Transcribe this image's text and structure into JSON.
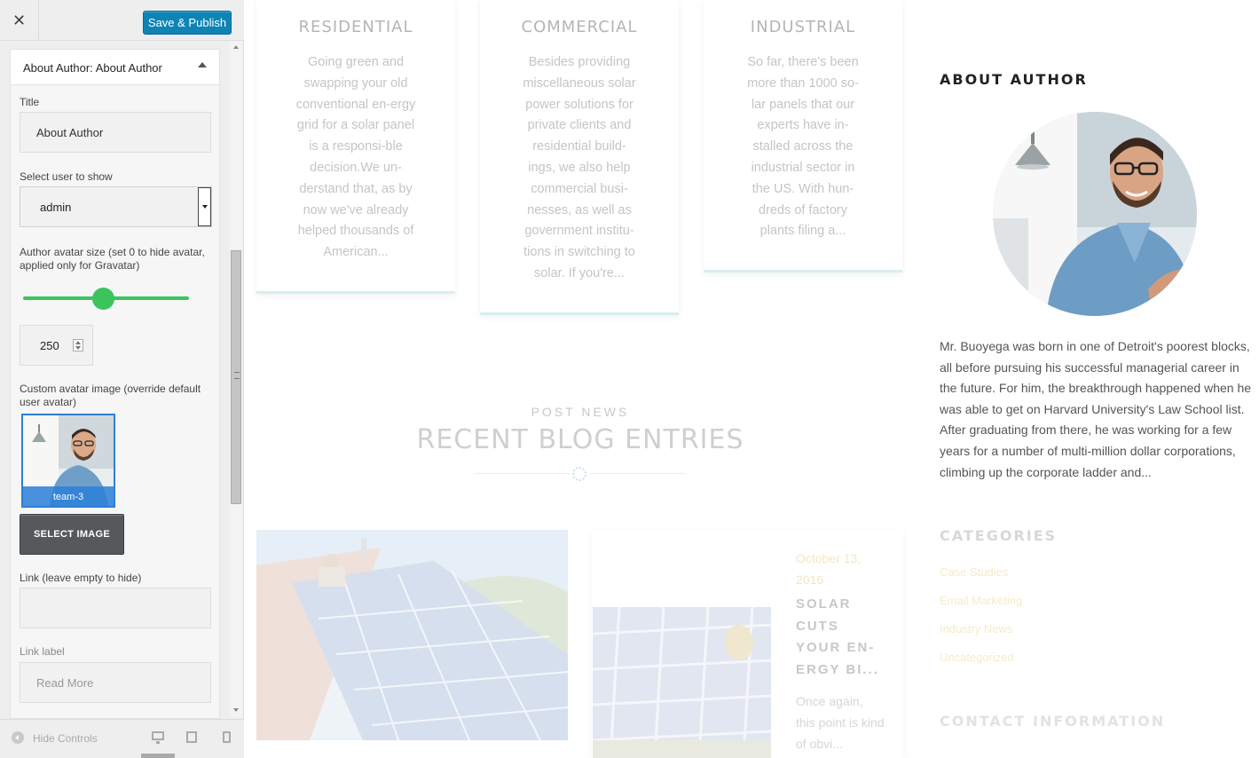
{
  "customizer": {
    "close_icon": "close-icon",
    "save_label": "Save & Publish",
    "widget_title_prefix": "About Author:",
    "widget_title": "About Author",
    "fields": {
      "title_label": "Title",
      "title_value": "About Author",
      "user_label": "Select user to show",
      "user_value": "admin",
      "avatar_size_label": "Author avatar size (set 0 to hide avatar, applied only for Gravatar)",
      "avatar_size_value": "250",
      "custom_avatar_label": "Custom avatar image (override default user avatar)",
      "custom_avatar_name": "team-3",
      "select_image_label": "SELECT IMAGE",
      "link_label": "Link (leave empty to hide)",
      "link_value": "",
      "link_label_label": "Link label",
      "link_label_placeholder": "Read More"
    },
    "footer": {
      "hide_controls": "Hide Controls",
      "devices": [
        "desktop-icon",
        "tablet-icon",
        "mobile-icon"
      ]
    },
    "colors": {
      "publish": "#0e84b5",
      "slider": "#3cc35c",
      "selected_thumb": "#2c7fd8"
    }
  },
  "preview": {
    "services": [
      {
        "title": "RESIDENTIAL",
        "text": "Going green and swapping your old conventional en-ergy grid for a solar panel is a responsi-ble decision.We un-derstand that, as by now we've already helped thousands of American..."
      },
      {
        "title": "COMMERCIAL",
        "text": "Besides providing miscellaneous solar power solutions for private clients and residential build-ings, we also help commercial busi-nesses, as well as government institu-tions in switching to solar. If you're..."
      },
      {
        "title": "INDUSTRIAL",
        "text": "So far, there's been more than 1000 so-lar panels that our experts have in-stalled across the industrial sector in the US. With hun-dreds of factory plants filing a..."
      }
    ],
    "blog": {
      "kicker": "POST NEWS",
      "title": "RECENT BLOG ENTRIES",
      "post2": {
        "date": "October 13, 2016",
        "title": "SOLAR CUTS YOUR EN-ERGY BI...",
        "excerpt": "Once again, this point is kind of obvi..."
      }
    },
    "sidebar": {
      "about_heading": "ABOUT AUTHOR",
      "bio": "Mr. Buoyega was born in one of Detroit's poorest blocks, all before pursuing his successful managerial career in the future. For him, the breakthrough happened when he was able to get on Harvard University's Law School list. After graduating from there, he was working for a few years for a number of multi-million dollar corporations, climbing up the corporate ladder and...",
      "categories_heading": "CATEGORIES",
      "categories": [
        "Case Studies",
        "Email Marketing",
        "Industry News",
        "Uncategorized"
      ],
      "contact_heading": "CONTACT INFORMATION"
    }
  }
}
